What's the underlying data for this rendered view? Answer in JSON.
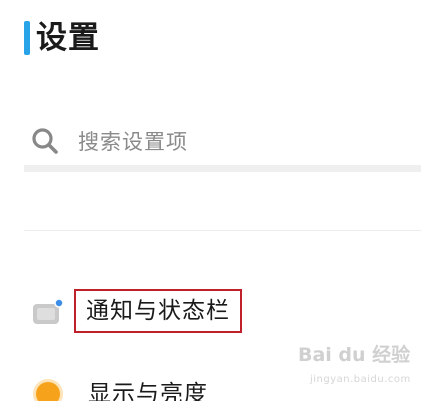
{
  "header": {
    "title": "设置"
  },
  "search": {
    "placeholder": "搜索设置项"
  },
  "settings": {
    "items": [
      {
        "label": "通知与状态栏",
        "icon": "notification-icon",
        "highlighted": true
      },
      {
        "label": "显示与亮度",
        "icon": "brightness-icon",
        "highlighted": false
      }
    ]
  },
  "watermark": {
    "text": "Bai du 经验",
    "subtext": "jingyan.baidu.com"
  },
  "colors": {
    "title_accent": "#29a3e8",
    "search_icon": "#888888",
    "notify_icon": "#c9c9c9",
    "notify_dot": "#3b8de8",
    "display_icon": "#f7a21b",
    "highlight_border": "#c0202a"
  }
}
